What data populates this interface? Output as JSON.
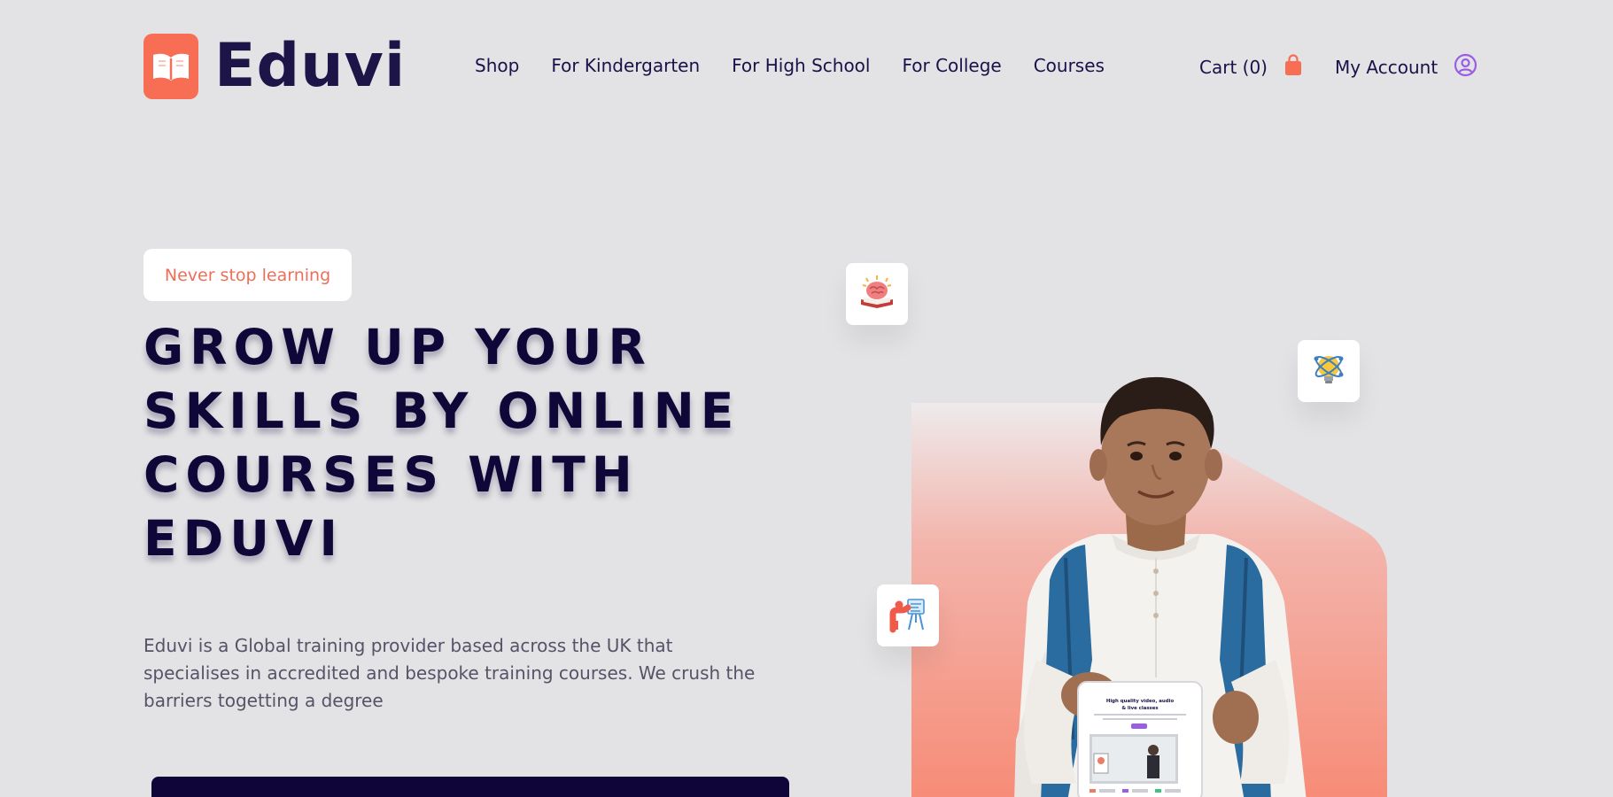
{
  "brand": {
    "name": "Eduvi",
    "logo_icon": "open-book-icon",
    "accent": "#f86e54",
    "dark": "#10053b"
  },
  "nav": {
    "items": [
      {
        "label": "Shop"
      },
      {
        "label": "For Kindergarten"
      },
      {
        "label": "For High School"
      },
      {
        "label": "For College"
      },
      {
        "label": "Courses"
      }
    ]
  },
  "header_actions": {
    "cart_label": "Cart (0)",
    "cart_icon": "shopping-bag-icon",
    "account_label": "My Account",
    "account_icon": "user-circle-icon"
  },
  "hero": {
    "tag": "Never stop learning",
    "headline_lines": [
      "GROW UP YOUR",
      "SKILLS BY ONLINE",
      "COURSES WITH",
      "EDUVI"
    ],
    "description_lines": [
      "Eduvi is a Global training provider based across the UK that",
      "specialises in accredited and bespoke training courses. We crush the",
      "barriers togetting a degree"
    ]
  },
  "feature_icons": [
    "brain-book-icon",
    "lightbulb-atom-icon",
    "teacher-board-icon"
  ],
  "tablet": {
    "title_line1": "High quality video, audio",
    "title_line2": "& live classes"
  }
}
